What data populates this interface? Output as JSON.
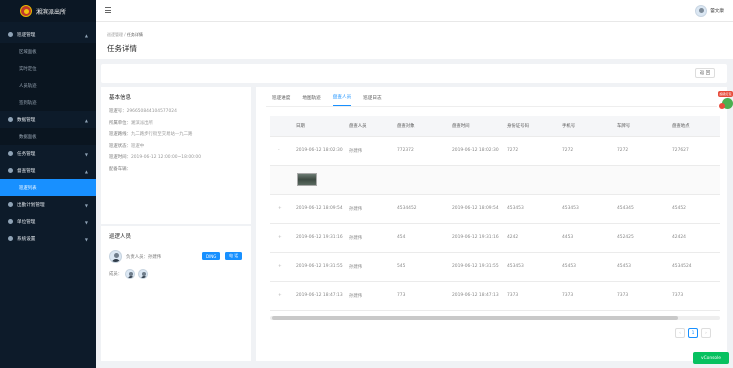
{
  "app": {
    "name": "湘滨派出所"
  },
  "header": {
    "username": "蕾文康"
  },
  "sidebar": {
    "groups": [
      {
        "label": "巡逻管理",
        "children": [
          "区域面板",
          "实时定位",
          "人员轨迹",
          "签到轨迹"
        ]
      },
      {
        "label": "数据管理",
        "children": [
          "数据面板"
        ]
      },
      {
        "label": "任务管理",
        "children": []
      },
      {
        "label": "督查管理",
        "children": [
          "巡逻列表"
        ]
      },
      {
        "label": "出勤计划管理",
        "children": []
      },
      {
        "label": "单位管理",
        "children": []
      },
      {
        "label": "系统设置",
        "children": []
      }
    ],
    "active_item": "巡逻列表"
  },
  "breadcrumb": {
    "parent": "巡逻管理",
    "separator": "/",
    "current": "任务详情"
  },
  "page_title": "任务详情",
  "back_button": "返 回",
  "basic_info": {
    "title": "基本信息",
    "fields": [
      {
        "key": "巡逻号：",
        "value": "296650844104577024"
      },
      {
        "key": "所属单位：",
        "value": "湘滨派出所"
      },
      {
        "key": "巡逻路线：",
        "value": "九二路步行街至交易站—九二路"
      },
      {
        "key": "巡逻状态：",
        "value": "巡逻中"
      },
      {
        "key": "巡逻时间：",
        "value": "2019-06-12 12:00:00~18:00:00"
      },
      {
        "key": "配备车辆：",
        "value": ""
      }
    ]
  },
  "patrol_people": {
    "title": "巡逻人员",
    "leader_label": "负责人员：孙建伟",
    "btn_ding": "DING",
    "btn_call": "电 话",
    "members_label": "成员："
  },
  "tabs": [
    "巡逻进度",
    "地图轨迹",
    "盘查人员",
    "巡逻日志"
  ],
  "active_tab": "盘查人员",
  "table": {
    "columns": [
      "",
      "日期",
      "盘查人员",
      "盘查对象",
      "盘查时间",
      "身份证号码",
      "手机号",
      "车牌号",
      "盘查地点"
    ],
    "rows": [
      {
        "expand": "-",
        "cells": [
          "2019-06-12 18:02:30",
          "孙建伟",
          "772372",
          "2019-06-12 18:02:30",
          "7272",
          "7272",
          "7272",
          "727627"
        ]
      },
      {
        "expand": "+",
        "cells": [
          "2019-06-12 18:09:54",
          "孙建伟",
          "4534452",
          "2019-06-12 18:09:54",
          "453453",
          "453453",
          "454345",
          "45452"
        ]
      },
      {
        "expand": "+",
        "cells": [
          "2019-06-12 19:31:16",
          "孙建伟",
          "454",
          "2019-06-12 19:31:16",
          "4242",
          "4453",
          "452425",
          "42424"
        ]
      },
      {
        "expand": "+",
        "cells": [
          "2019-06-12 19:31:55",
          "孙建伟",
          "545",
          "2019-06-12 19:31:55",
          "453453",
          "45453",
          "45453",
          "4534524"
        ]
      },
      {
        "expand": "+",
        "cells": [
          "2019-06-12 18:47:13",
          "孙建伟",
          "773",
          "2019-06-12 18:47:13",
          "7373",
          "7373",
          "7373",
          "7373"
        ]
      }
    ]
  },
  "pagination": {
    "prev": "‹",
    "current": "1",
    "next": "›"
  },
  "vconsole": "vConsole",
  "float_badge": "超级红包"
}
